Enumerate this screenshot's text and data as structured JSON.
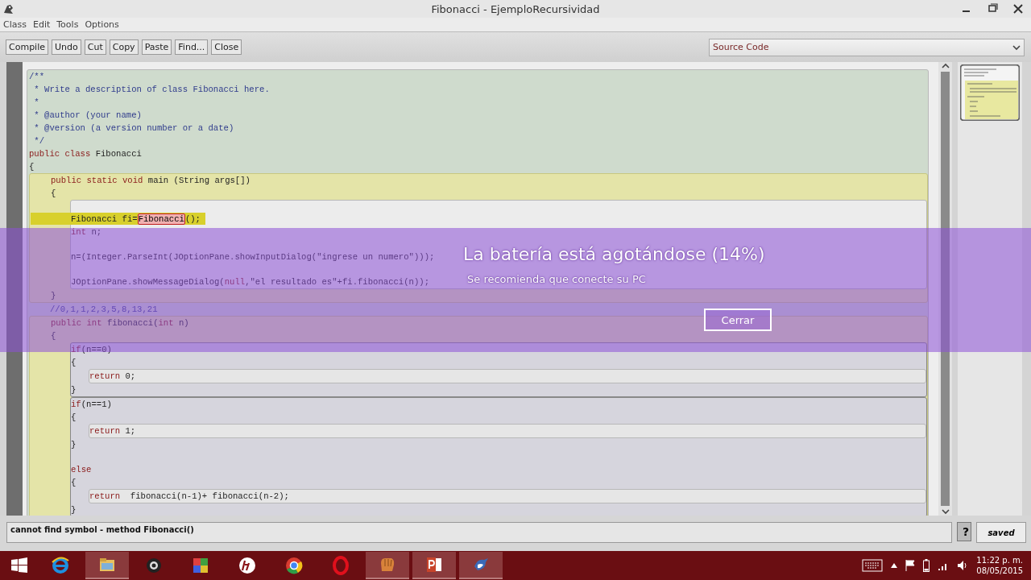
{
  "window": {
    "title": "Fibonacci - EjemploRecursividad"
  },
  "menu": [
    "Class",
    "Edit",
    "Tools",
    "Options"
  ],
  "toolbar": [
    "Compile",
    "Undo",
    "Cut",
    "Copy",
    "Paste",
    "Find...",
    "Close"
  ],
  "view_select": {
    "value": "Source Code"
  },
  "editor": {
    "items": [
      {
        "kind": "class_scope",
        "items": [
          {
            "kind": "line",
            "tokens": [
              {
                "kind": "comment",
                "text": "/**"
              }
            ]
          },
          {
            "kind": "line",
            "tokens": [
              {
                "kind": "comment",
                "text": " * Write a description of class Fibonacci here."
              }
            ]
          },
          {
            "kind": "line",
            "tokens": [
              {
                "kind": "comment",
                "text": " *"
              }
            ]
          },
          {
            "kind": "line",
            "tokens": [
              {
                "kind": "comment",
                "text": " * @author (your name)"
              }
            ]
          },
          {
            "kind": "line",
            "tokens": [
              {
                "kind": "comment",
                "text": " * @version (a version number or a date)"
              }
            ]
          },
          {
            "kind": "line",
            "tokens": [
              {
                "kind": "comment",
                "text": " */"
              }
            ]
          },
          {
            "kind": "line",
            "tokens": [
              {
                "kind": "keyword",
                "text": "public class"
              },
              {
                "kind": "plain",
                "text": " Fibonacci"
              }
            ]
          },
          {
            "kind": "line",
            "tokens": [
              {
                "kind": "plain",
                "text": "{"
              }
            ]
          },
          {
            "kind": "method_scope",
            "items": [
              {
                "kind": "line",
                "tokens": [
                  {
                    "kind": "keyword",
                    "text": "public static void"
                  },
                  {
                    "kind": "plain",
                    "text": " main (String args[])"
                  }
                ]
              },
              {
                "kind": "line",
                "tokens": [
                  {
                    "kind": "plain",
                    "text": "{"
                  }
                ]
              },
              {
                "kind": "body_scope",
                "items": [
                  {
                    "kind": "blank"
                  },
                  {
                    "kind": "line",
                    "highlighted": true,
                    "tokens": [
                      {
                        "kind": "plain",
                        "text": "Fibonacci fi="
                      },
                      {
                        "kind": "error",
                        "text": "Fibonacci"
                      },
                      {
                        "kind": "plain",
                        "text": "();"
                      }
                    ]
                  },
                  {
                    "kind": "line",
                    "tokens": [
                      {
                        "kind": "keyword",
                        "text": "int"
                      },
                      {
                        "kind": "plain",
                        "text": " n;"
                      }
                    ]
                  },
                  {
                    "kind": "blank"
                  },
                  {
                    "kind": "line",
                    "tokens": [
                      {
                        "kind": "plain",
                        "text": "n=(Integer.ParseInt(JOptionPane.showInputDialog(\"ingrese un numero\")));"
                      }
                    ]
                  },
                  {
                    "kind": "blank"
                  },
                  {
                    "kind": "line",
                    "tokens": [
                      {
                        "kind": "plain",
                        "text": "JOptionPane.showMessageDialog("
                      },
                      {
                        "kind": "keyword",
                        "text": "null"
                      },
                      {
                        "kind": "plain",
                        "text": ",\"el resultado es\"+fi.fibonacci(n));"
                      }
                    ]
                  }
                ]
              },
              {
                "kind": "line",
                "tokens": [
                  {
                    "kind": "plain",
                    "text": "}"
                  }
                ]
              }
            ]
          },
          {
            "kind": "plain_scope",
            "items": [
              {
                "kind": "line",
                "tokens": [
                  {
                    "kind": "comment",
                    "text": "//0,1,1,2,3,5,8,13,21"
                  }
                ]
              }
            ]
          },
          {
            "kind": "method_scope",
            "items": [
              {
                "kind": "line",
                "tokens": [
                  {
                    "kind": "keyword",
                    "text": "public int"
                  },
                  {
                    "kind": "plain",
                    "text": " fibonacci("
                  },
                  {
                    "kind": "keyword",
                    "text": "int"
                  },
                  {
                    "kind": "plain",
                    "text": " n)"
                  }
                ]
              },
              {
                "kind": "line",
                "tokens": [
                  {
                    "kind": "plain",
                    "text": "{"
                  }
                ]
              },
              {
                "kind": "branch_scope",
                "items": [
                  {
                    "kind": "line",
                    "tokens": [
                      {
                        "kind": "keyword",
                        "text": "if"
                      },
                      {
                        "kind": "plain",
                        "text": "(n==0)"
                      }
                    ]
                  },
                  {
                    "kind": "line",
                    "tokens": [
                      {
                        "kind": "plain",
                        "text": "{"
                      }
                    ]
                  },
                  {
                    "kind": "inner_scope",
                    "items": [
                      {
                        "kind": "line",
                        "tokens": [
                          {
                            "kind": "keyword",
                            "text": "return"
                          },
                          {
                            "kind": "plain",
                            "text": " 0;"
                          }
                        ]
                      }
                    ]
                  },
                  {
                    "kind": "line",
                    "tokens": [
                      {
                        "kind": "plain",
                        "text": "}"
                      }
                    ]
                  }
                ]
              },
              {
                "kind": "branch_scope",
                "items": [
                  {
                    "kind": "line",
                    "tokens": [
                      {
                        "kind": "keyword",
                        "text": "if"
                      },
                      {
                        "kind": "plain",
                        "text": "(n==1)"
                      }
                    ]
                  },
                  {
                    "kind": "line",
                    "tokens": [
                      {
                        "kind": "plain",
                        "text": "{"
                      }
                    ]
                  },
                  {
                    "kind": "inner_scope",
                    "items": [
                      {
                        "kind": "line",
                        "tokens": [
                          {
                            "kind": "keyword",
                            "text": "return"
                          },
                          {
                            "kind": "plain",
                            "text": " 1;"
                          }
                        ]
                      }
                    ]
                  },
                  {
                    "kind": "line",
                    "tokens": [
                      {
                        "kind": "plain",
                        "text": "}"
                      }
                    ]
                  },
                  {
                    "kind": "blank"
                  },
                  {
                    "kind": "line",
                    "tokens": [
                      {
                        "kind": "keyword",
                        "text": "else"
                      }
                    ]
                  },
                  {
                    "kind": "line",
                    "tokens": [
                      {
                        "kind": "plain",
                        "text": "{"
                      }
                    ]
                  },
                  {
                    "kind": "inner_scope",
                    "items": [
                      {
                        "kind": "line",
                        "tokens": [
                          {
                            "kind": "keyword",
                            "text": "return"
                          },
                          {
                            "kind": "plain",
                            "text": "  fibonacci(n-1)+ fibonacci(n-2);"
                          }
                        ]
                      }
                    ]
                  },
                  {
                    "kind": "line",
                    "tokens": [
                      {
                        "kind": "plain",
                        "text": "}"
                      }
                    ]
                  }
                ]
              }
            ]
          }
        ]
      }
    ]
  },
  "notification": {
    "title": "La batería está agotándose (14%)",
    "message": "Se recomienda que conecte su PC",
    "button": "Cerrar"
  },
  "status_bar": {
    "message": "cannot find symbol -   method Fibonacci()",
    "help": "?",
    "state": "saved"
  },
  "taskbar": {
    "apps": [
      {
        "running": false
      },
      {
        "running": true
      },
      {
        "running": false
      },
      {
        "running": false
      },
      {
        "running": false
      },
      {
        "running": false
      },
      {
        "running": false
      },
      {
        "running": true
      },
      {
        "running": true
      },
      {
        "running": true
      }
    ],
    "time": "11:22 p. m.",
    "date": "08/05/2015"
  }
}
